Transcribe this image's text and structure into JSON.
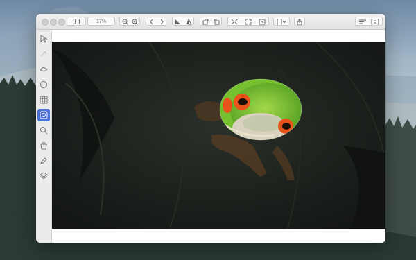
{
  "window": {
    "zoom_level": "17%"
  },
  "toolbar": {
    "sidebar_toggle": "sidebar-toggle-icon",
    "zoom_out": "zoom-out-icon",
    "zoom_in": "zoom-in-icon",
    "back": "back-icon",
    "forward": "forward-icon",
    "flip_horizontal": "flip-horizontal-icon",
    "flip_vertical": "flip-vertical-icon",
    "rotate_left": "rotate-left-icon",
    "rotate_right": "rotate-right-icon",
    "fit": "fit-icon",
    "actual_size": "actual-size-icon",
    "fullscreen": "fullscreen-icon",
    "crop_menu": "crop-menu-icon",
    "share": "share-icon",
    "align": "align-icon",
    "inspector": "inspector-icon"
  },
  "tools": [
    {
      "name": "select",
      "icon": "arrow-icon"
    },
    {
      "name": "lasso",
      "icon": "lasso-icon"
    },
    {
      "name": "eraser",
      "icon": "eraser-icon"
    },
    {
      "name": "ellipse",
      "icon": "circle-icon"
    },
    {
      "name": "grid",
      "icon": "grid-icon"
    },
    {
      "name": "target",
      "icon": "target-icon",
      "active": true
    },
    {
      "name": "zoom",
      "icon": "magnifier-icon"
    },
    {
      "name": "fill",
      "icon": "bucket-icon"
    },
    {
      "name": "pencil",
      "icon": "pencil-icon"
    },
    {
      "name": "layers",
      "icon": "layers-icon"
    }
  ],
  "colors": {
    "accent": "#4b6fd8",
    "canvas_background": "#1a1e1a",
    "frog_green": "#6cc02a",
    "frog_eye_red": "#e8541b"
  }
}
